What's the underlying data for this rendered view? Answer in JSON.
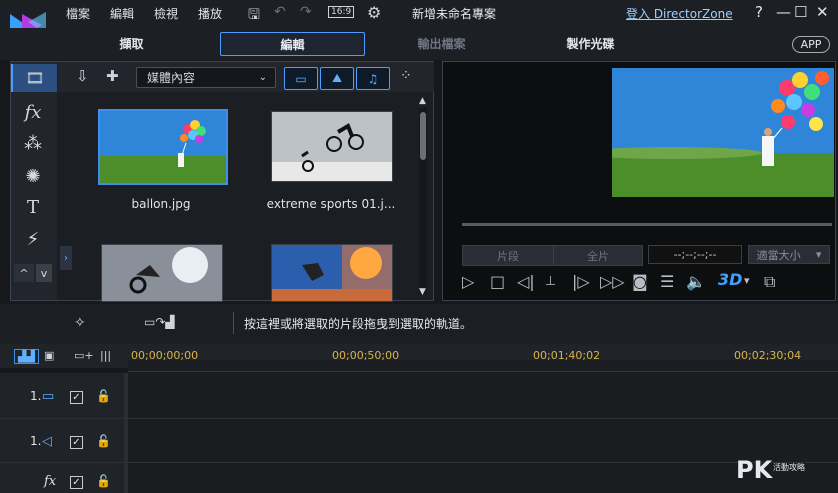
{
  "menu": [
    "檔案",
    "編輯",
    "檢視",
    "播放"
  ],
  "toolbar": {
    "aspect_ratio": "16:9"
  },
  "project_title": "新增未命名專案",
  "login_link": "登入 DirectorZone",
  "window_controls": [
    "?",
    "—",
    "☐",
    "✕"
  ],
  "mode_tabs": [
    "擷取",
    "編輯",
    "輸出檔案",
    "製作光碟"
  ],
  "app_badge": "APP",
  "library": {
    "room_select": "媒體內容",
    "items": [
      {
        "caption": "ballon.jpg"
      },
      {
        "caption": "extreme sports 01.j..."
      },
      {
        "caption": ""
      },
      {
        "caption": ""
      }
    ]
  },
  "preview": {
    "segment_btn": "片段",
    "full_btn": "全片",
    "timecode": "--;--;--;--",
    "fit_select": "適當大小",
    "threed": "3D"
  },
  "hint": "按這裡或將選取的片段拖曳到選取的軌道。",
  "timeline": {
    "times": [
      "00;00;00;00",
      "00;00;50;00",
      "00;01;40;02",
      "00;02;30;04"
    ],
    "tracks": [
      "1.",
      "1.",
      ""
    ]
  },
  "watermark": {
    "main": "PK",
    "sub": "活動攻略"
  },
  "colors": {
    "accent": "#3e8eea",
    "timecode": "#d9b24a",
    "link": "#9fd1ff"
  }
}
